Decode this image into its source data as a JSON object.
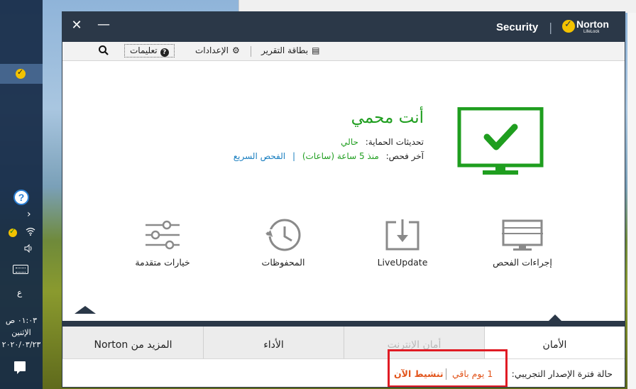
{
  "window": {
    "product": "Security",
    "brand": "Norton",
    "brand_sub": "LifeLock"
  },
  "toolbar": {
    "help_label": "تعليمات",
    "settings_label": "الإعدادات",
    "report_label": "بطاقة التقرير"
  },
  "status": {
    "title": "أنت محمي",
    "updates_label": "تحديثات الحماية:",
    "updates_value": "حالي",
    "last_scan_label": "آخر فحص:",
    "last_scan_value": "منذ 5 ساعة (ساعات)",
    "quick_scan_link": "الفحص السريع",
    "color": "#1f9e1f"
  },
  "tiles": [
    {
      "label": "خيارات متقدمة",
      "icon": "sliders-icon"
    },
    {
      "label": "المحفوظات",
      "icon": "history-icon"
    },
    {
      "label": "LiveUpdate",
      "icon": "download-icon"
    },
    {
      "label": "إجراءات الفحص",
      "icon": "scan-monitor-icon"
    }
  ],
  "tabs": [
    {
      "label": "الأمان",
      "state": "active"
    },
    {
      "label": "أمان الإنترنت",
      "state": "disabled"
    },
    {
      "label": "الأداء",
      "state": "normal"
    },
    {
      "label": "المزيد من Norton",
      "state": "normal"
    }
  ],
  "trial": {
    "status_label": "حالة فترة الإصدار التجريبي:",
    "days_left": "1 يوم باقي",
    "activate_label": "تنشيط الآن",
    "accent_color": "#e2541b",
    "highlight_color": "#e01b24"
  },
  "taskbar": {
    "lang": "ع",
    "time": "٠١:٠٣ ص",
    "day": "الإثنين",
    "date": "٢٠٢٠/٠٣/٢٣"
  }
}
